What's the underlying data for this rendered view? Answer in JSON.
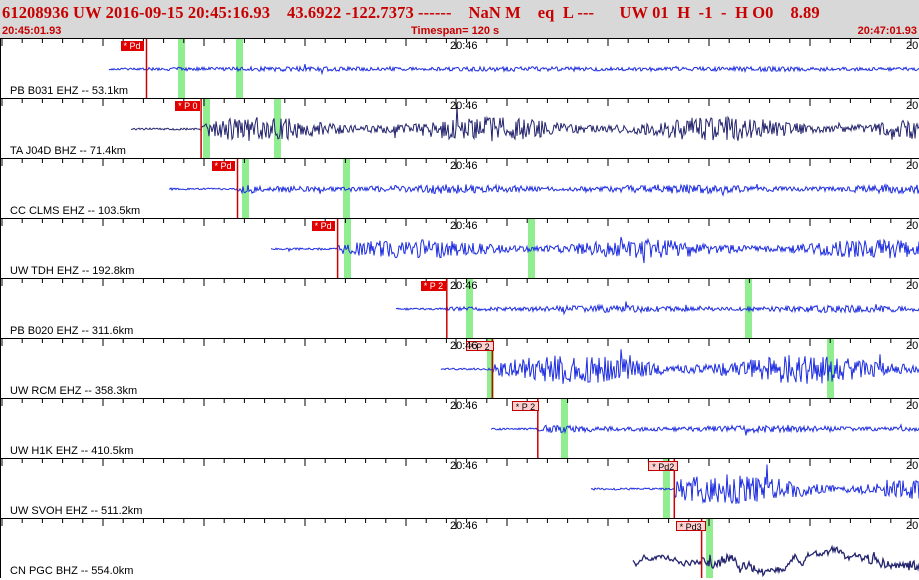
{
  "header": {
    "event_id": "61208936",
    "network": "UW",
    "date": "2016-09-15",
    "time": "20:45:16.93",
    "lat": "43.6922",
    "lon": "-122.7373",
    "depth": "------",
    "magnitude": "NaN",
    "mag_type": "M",
    "event_type": "eq",
    "geo_type": "L",
    "extra": "---",
    "agency": "UW",
    "version": "01",
    "h": "H",
    "h_val": "-1",
    "ho": "H",
    "o_val": "O0",
    "value": "8.89",
    "start_time": "20:45:01.93",
    "timespan": "Timespan= 120 s",
    "end_time": "20:47:01.93"
  },
  "tick_labels": {
    "mid": "20:46",
    "edge": "20"
  },
  "traces": [
    {
      "label": "PB B031 EHZ -- 53.1km",
      "pick": "* Pd",
      "pick_style": "dark",
      "color": "#1e2de0",
      "amplitude": 0.05,
      "arrival": 0.15
    },
    {
      "label": "TA J04D BHZ -- 71.4km",
      "pick": "* P 0",
      "pick_style": "dark",
      "color": "#24246e",
      "amplitude": 0.6,
      "arrival": 0.21
    },
    {
      "label": "CC CLMS EHZ -- 103.5km",
      "pick": "* Pd",
      "pick_style": "dark",
      "color": "#1e2de0",
      "amplitude": 0.18,
      "arrival": 0.25
    },
    {
      "label": "UW TDH EHZ -- 192.8km",
      "pick": "* Pd",
      "pick_style": "dark",
      "color": "#1e2de0",
      "amplitude": 0.45,
      "arrival": 0.36
    },
    {
      "label": "PB B020 EHZ -- 311.6km",
      "pick": "* P 2",
      "pick_style": "dark",
      "color": "#1e2de0",
      "amplitude": 0.12,
      "arrival": 0.48
    },
    {
      "label": "UW RCM EHZ -- 358.3km",
      "pick": "* P 2",
      "pick_style": "light",
      "color": "#1e2de0",
      "amplitude": 0.75,
      "arrival": 0.53
    },
    {
      "label": "UW H1K EHZ -- 410.5km",
      "pick": "* P 2",
      "pick_style": "light",
      "color": "#1e2de0",
      "amplitude": 0.12,
      "arrival": 0.58
    },
    {
      "label": "UW SVOH EHZ -- 511.2km",
      "pick": "* Pd2",
      "pick_style": "light",
      "color": "#1e2de0",
      "amplitude": 0.75,
      "arrival": 0.73
    },
    {
      "label": "CN PGC BHZ -- 554.0km",
      "pick": "* Pd3",
      "pick_style": "light",
      "color": "#24246e",
      "amplitude": 0.6,
      "arrival": 0.76
    }
  ]
}
